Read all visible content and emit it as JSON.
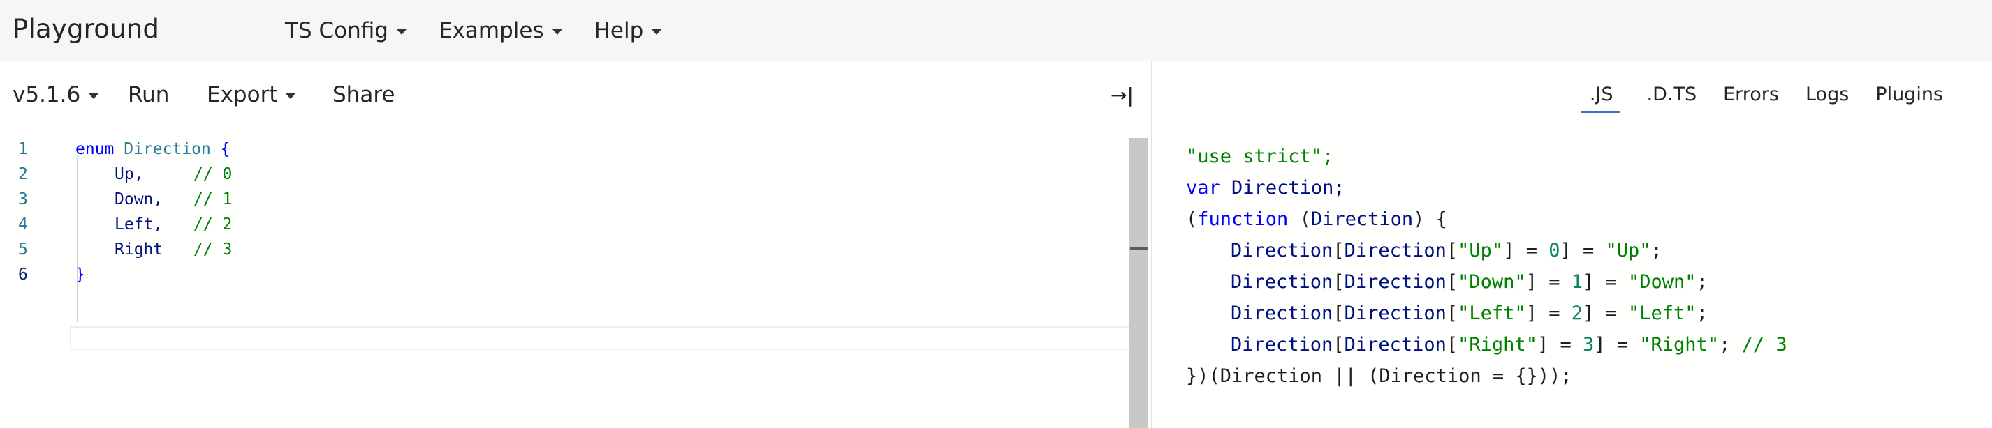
{
  "nav": {
    "brand": "Playground",
    "menus": [
      "TS Config",
      "Examples",
      "Help"
    ]
  },
  "toolbar": {
    "version": "v5.1.6",
    "run": "Run",
    "export": "Export",
    "share": "Share",
    "collapse_icon": "→|"
  },
  "editor": {
    "line_numbers": [
      "1",
      "2",
      "3",
      "4",
      "5",
      "6"
    ],
    "lines": [
      {
        "kw": "enum",
        "name": "Direction",
        "brace": "{"
      },
      {
        "member": "Up,",
        "comment": "// 0"
      },
      {
        "member": "Down,",
        "comment": "// 1"
      },
      {
        "member": "Left,",
        "comment": "// 2"
      },
      {
        "member": "Right",
        "comment": "// 3"
      },
      {
        "brace": "}"
      }
    ]
  },
  "output_tabs": [
    ".JS",
    ".D.TS",
    "Errors",
    "Logs",
    "Plugins"
  ],
  "active_output_tab": ".JS",
  "output": {
    "l1": "\"use strict\";",
    "l2_kw": "var",
    "l2_rest": "Direction;",
    "l3_a": "(",
    "l3_kw": "function",
    "l3_b": " (",
    "l3_id": "Direction",
    "l3_c": ") {",
    "assign": [
      {
        "key": "\"Up\"",
        "num": "0",
        "val": "\"Up\"",
        "comment": ""
      },
      {
        "key": "\"Down\"",
        "num": "1",
        "val": "\"Down\"",
        "comment": ""
      },
      {
        "key": "\"Left\"",
        "num": "2",
        "val": "\"Left\"",
        "comment": ""
      },
      {
        "key": "\"Right\"",
        "num": "3",
        "val": "\"Right\"",
        "comment": "// 3"
      }
    ],
    "last": "})(Direction || (Direction = {}));"
  }
}
